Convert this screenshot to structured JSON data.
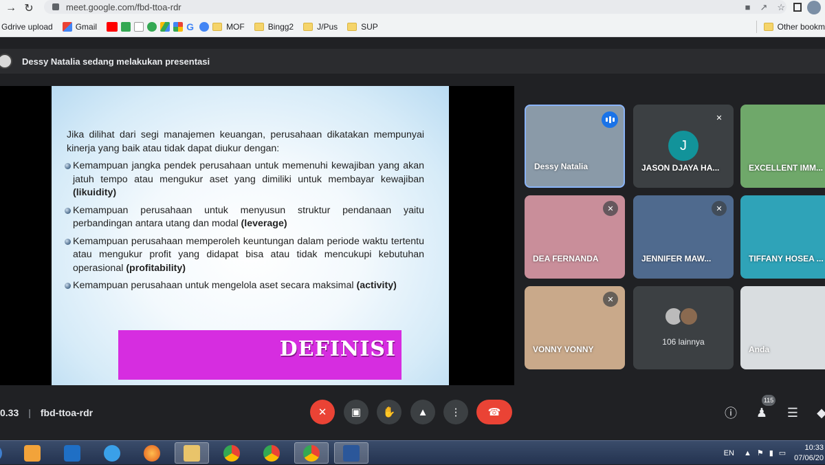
{
  "browser": {
    "url": "meet.google.com/fbd-ttoa-rdr",
    "bookmarks": [
      "Gdrive upload",
      "Gmail"
    ],
    "folders": [
      "MOF",
      "Bingg2",
      "J/Pus",
      "SUP"
    ],
    "other_bookmarks": "Other bookm"
  },
  "presenter": {
    "text": "Dessy Natalia sedang melakukan presentasi"
  },
  "slide": {
    "intro": "Jika dilihat dari segi manajemen keuangan, perusahaan dikatakan mempunyai kinerja yang baik atau tidak dapat diukur dengan:",
    "bullets": [
      {
        "text": "Kemampuan jangka pendek perusahaan untuk memenuhi kewajiban yang akan jatuh tempo atau mengukur aset yang dimiliki untuk membayar kewajiban",
        "term": "(likuidity)"
      },
      {
        "text": "Kemampuan perusahaan untuk menyusun struktur pendanaan yaitu perbandingan antara utang dan modal",
        "term": "(leverage)"
      },
      {
        "text": "Kemampuan perusahaan memperoleh keuntungan dalam periode waktu tertentu atau mengukur profit yang didapat bisa atau tidak mencukupi kebutuhan operasional",
        "term": "(profitability)"
      },
      {
        "text": "Kemampuan perusahaan untuk mengelola aset secara maksimal",
        "term": "(activity)"
      }
    ],
    "banner": "DEFINISI"
  },
  "participants": [
    {
      "name": "Dessy Natalia",
      "color": "#8a9aa8"
    },
    {
      "name": "JASON DJAYA HA...",
      "initial": "J",
      "color": "#3c4043"
    },
    {
      "name": "EXCELLENT IMM...",
      "color": "#6fa86a"
    },
    {
      "name": "DEA FERNANDA",
      "color": "#c98e9a"
    },
    {
      "name": "JENNIFER MAW...",
      "color": "#4f6a8e"
    },
    {
      "name": "TIFFANY HOSEA ...",
      "color": "#2fa3b8"
    },
    {
      "name": "VONNY VONNY",
      "color": "#c9a98a"
    },
    {
      "name": "Anda",
      "color": "#d9dde0"
    }
  ],
  "more": {
    "label": "106 lainnya"
  },
  "meeting": {
    "time": "0.33",
    "code": "fbd-ttoa-rdr",
    "people_count": "115"
  },
  "taskbar": {
    "lang": "EN",
    "time": "10:33",
    "date": "07/06/20"
  },
  "colors": {
    "meet_bg": "#202124",
    "end_call": "#ea4335",
    "speaking": "#1a73e8"
  }
}
